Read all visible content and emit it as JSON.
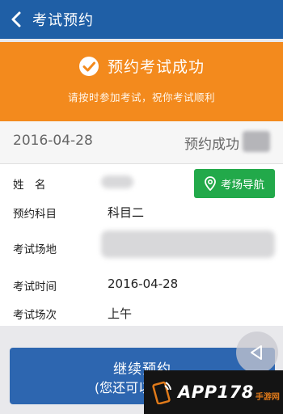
{
  "topbar": {
    "title": "考试预约"
  },
  "banner": {
    "title": "预约考试成功",
    "subtitle": "请按时参加考试，祝你考试顺利"
  },
  "summary": {
    "date": "2016-04-28",
    "status": "预约成功"
  },
  "details": {
    "name_label": "姓　名",
    "subject_label": "预约科目",
    "subject_value": "科目二",
    "venue_label": "考试场地",
    "time_label": "考试时间",
    "time_value": "2016-04-28",
    "session_label": "考试场次",
    "session_value": "上午",
    "nav_button": "考场导航"
  },
  "continue": {
    "label": "继续预约",
    "sub": "(您还可以继续预"
  },
  "watermark": {
    "brand": "APP178",
    "sub": "手游网"
  },
  "colors": {
    "topbar": "#1f5fa6",
    "banner": "#f38a1d",
    "nav_button": "#22a94a",
    "continue_button": "#2d66b0"
  }
}
